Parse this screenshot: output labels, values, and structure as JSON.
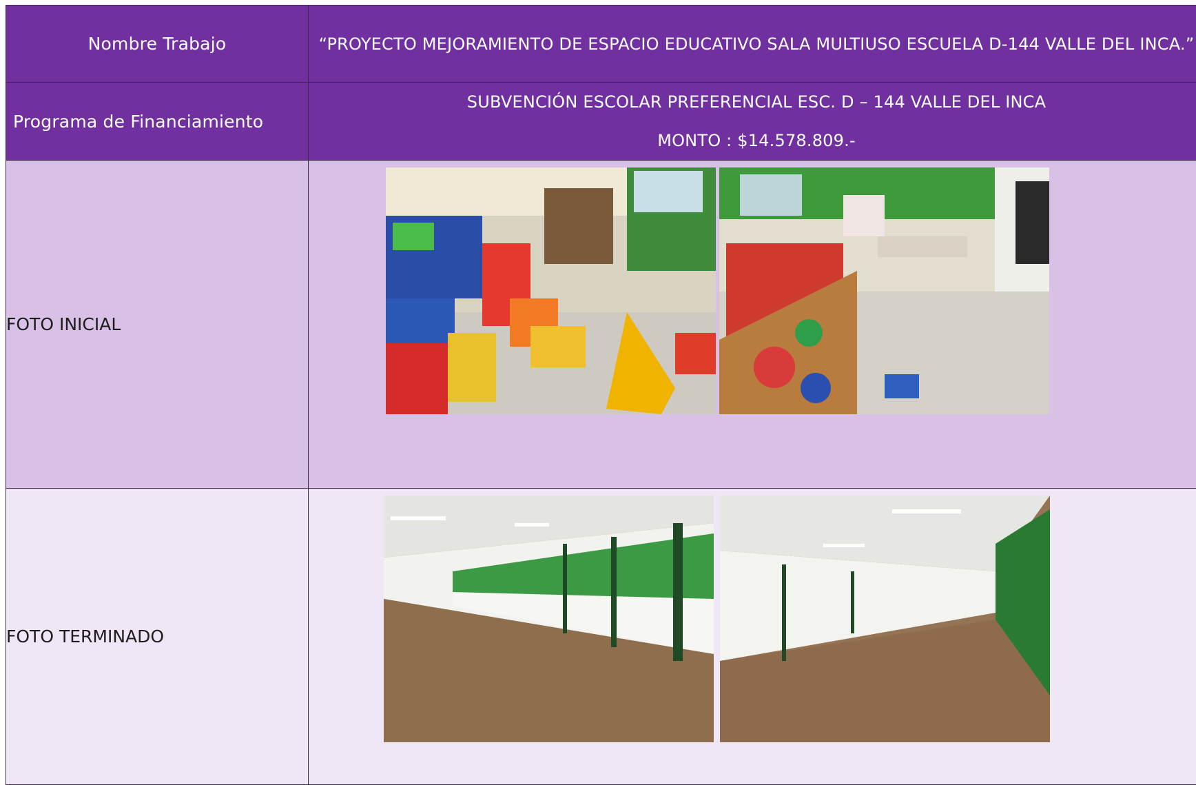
{
  "rows": {
    "nombre_trabajo": {
      "label": "Nombre Trabajo",
      "value": "“PROYECTO MEJORAMIENTO DE ESPACIO EDUCATIVO SALA MULTIUSO ESCUELA D-144 VALLE DEL INCA.”"
    },
    "programa": {
      "label": "Programa de Financiamiento",
      "line1": "SUBVENCIÓN ESCOLAR PREFERENCIAL ESC. D – 144 VALLE DEL INCA",
      "line2": "MONTO : $14.578.809.-"
    },
    "foto_inicial": {
      "label": "FOTO INICIAL",
      "photos": [
        "cluttered-room-with-foam-blocks",
        "room-with-sports-equipment-crate"
      ]
    },
    "foto_terminado": {
      "label": "FOTO TERMINADO",
      "photos": [
        "renovated-hall-green-windows",
        "renovated-hall-long-view"
      ]
    }
  },
  "colors": {
    "header_purple": "#7030a0",
    "row_light": "#d8c0e6",
    "row_lighter": "#efe6f6"
  }
}
